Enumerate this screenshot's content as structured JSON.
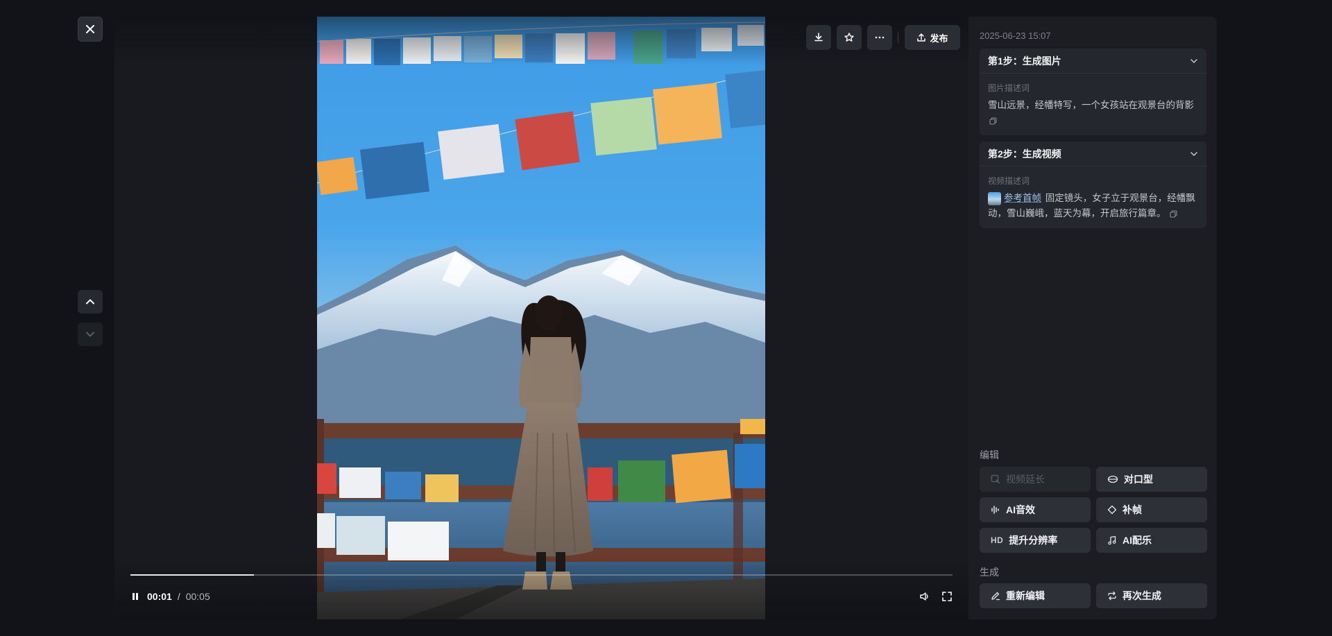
{
  "navigation": {
    "close_icon": "close-icon",
    "prev_icon": "chevron-up-icon",
    "next_icon": "chevron-down-icon"
  },
  "toolbar": {
    "download_icon": "download-icon",
    "favorite_icon": "star-icon",
    "more_icon": "more-icon",
    "publish_label": "发布",
    "publish_icon": "upload-icon"
  },
  "player": {
    "state": "playing",
    "current_time": "00:01",
    "separator": "/",
    "total_time": "00:05",
    "progress_fraction": 0.15,
    "volume_icon": "volume-icon",
    "fullscreen_icon": "fullscreen-icon"
  },
  "sidebar": {
    "timestamp": "2025-06-23 15:07",
    "steps": [
      {
        "title": "第1步：生成图片",
        "label": "图片描述词",
        "text": "雪山远景，经幡特写，一个女孩站在观景台的背影"
      },
      {
        "title": "第2步：生成视频",
        "label": "视频描述词",
        "ref_label": "参考首帧",
        "text": "固定镜头，女子立于观景台，经幡飘动，雪山巍峨，蓝天为幕，开启旅行篇章。"
      }
    ],
    "edit_section": {
      "title": "编辑",
      "buttons": [
        {
          "label": "视频延长",
          "icon": "extend-icon",
          "disabled": true
        },
        {
          "label": "对口型",
          "icon": "lips-icon",
          "disabled": false
        },
        {
          "label": "AI音效",
          "icon": "sound-wave-icon",
          "disabled": false
        },
        {
          "label": "补帧",
          "icon": "diamond-icon",
          "disabled": false
        },
        {
          "label": "提升分辨率",
          "icon": "hd-icon",
          "icon_text": "HD",
          "disabled": false
        },
        {
          "label": "AI配乐",
          "icon": "music-note-icon",
          "disabled": false
        }
      ]
    },
    "generate_section": {
      "title": "生成",
      "buttons": [
        {
          "label": "重新编辑",
          "icon": "pencil-icon"
        },
        {
          "label": "再次生成",
          "icon": "repeat-icon"
        }
      ]
    }
  },
  "colors": {
    "background": "#111318",
    "panel": "#181a1f",
    "sidebar": "#1b1d22",
    "card": "#24272d",
    "button": "#2d3037"
  }
}
